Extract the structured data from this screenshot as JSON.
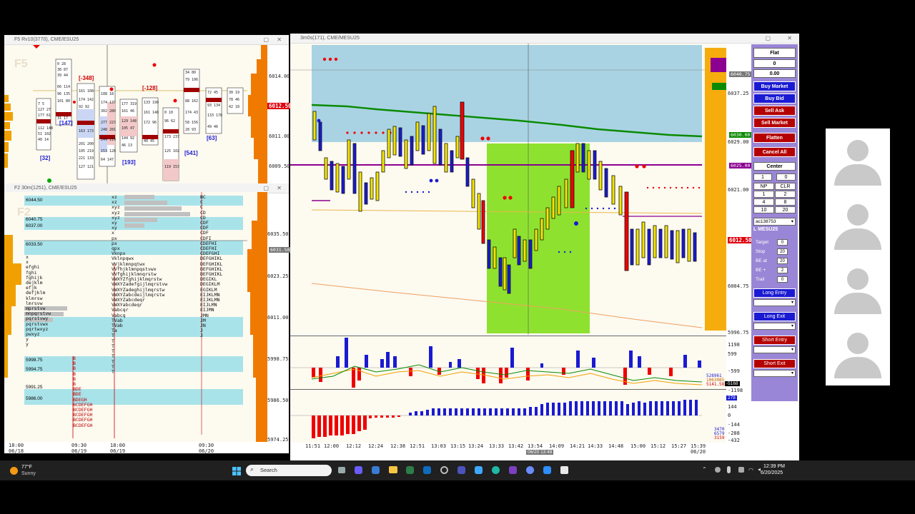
{
  "windows": {
    "f5": {
      "title": "F5 Rv10(3770), CME/ESU25",
      "watermark": "F5"
    },
    "f2": {
      "title": "F2 30m(1251), CME/ESU25",
      "watermark": "F2"
    },
    "main": {
      "title": "3m0s(171), CME/MESU25"
    }
  },
  "f5_prices": [
    "6014.00",
    "6011.00",
    "6009.50"
  ],
  "f5_current": "6012.50",
  "f5_labels": {
    "d1": "[-348]",
    "d2": "[-128]",
    "d3": "[147]",
    "d4": "[32]",
    "d5": "[193]",
    "d6": "[541]",
    "d7": "[63]"
  },
  "f2_left_prices": [
    "6044.50",
    "6040.75",
    "6037.00",
    "6033.50",
    "5998.75",
    "5994.75",
    "5991.25",
    "5986.00"
  ],
  "f2_right_prices": [
    "6035.50",
    "6023.25",
    "6011.00",
    "5998.75",
    "5986.50",
    "5974.25"
  ],
  "f2_tag": "6031.50",
  "f2_times": [
    {
      "t": "18:00",
      "d": "06/18"
    },
    {
      "t": "09:30",
      "d": "06/19"
    },
    {
      "t": "18:00",
      "d": "06/19"
    },
    {
      "t": "09:30",
      "d": "06/20"
    }
  ],
  "main_prices": [
    "6037.25",
    "6029.00",
    "6021.00",
    "6012.50",
    "6004.75",
    "5996.75"
  ],
  "main_tags": {
    "grey": "6040.75",
    "green": "6030.00",
    "purple": "6025.00",
    "red": "6012.50"
  },
  "volume_scale": [
    "1198",
    "599",
    "-599",
    "-1198"
  ],
  "volume_values": [
    "528961",
    "1063085",
    "5141.58",
    "-5168"
  ],
  "delta_scale": [
    "278",
    "144",
    "0",
    "-144",
    "-288",
    "-432"
  ],
  "delta_values": [
    "3470",
    "6579",
    "3159"
  ],
  "main_times": [
    "11:51",
    "12:00",
    "12:12",
    "12:24",
    "12:38",
    "12:51",
    "13:03",
    "13:15",
    "13:24",
    "13:33",
    "13:42",
    "13:54",
    "14:09",
    "14:21",
    "14:33",
    "14:48",
    "15:00",
    "15:12",
    "15:27",
    "15:39"
  ],
  "main_time_last_date": "06/20",
  "cursor_time": "06/20 13:48",
  "panel": {
    "status": "Flat",
    "position": "0",
    "pnl": "0.00",
    "buy_market": "Buy Market",
    "buy_bid": "Buy Bid",
    "sell_ask": "Sell Ask",
    "sell_market": "Sell Market",
    "flatten": "Flatten",
    "cancel_all": "Cancel All",
    "center": "Center",
    "qty": "1",
    "qty_right": "0",
    "np": "NP",
    "clr": "CLR",
    "q_buttons": [
      "1",
      "2",
      "4",
      "8",
      "10",
      "20"
    ],
    "account": "ac138753",
    "symbol": "L MESU25",
    "target_label": "Target",
    "target": "0",
    "stop_label": "Stop",
    "stop": "20",
    "beat_label": "BE at",
    "beat": "20",
    "beplus_label": "BE +",
    "beplus": "2",
    "trail_label": "Trail",
    "trail": "0",
    "long_entry": "Long Entry",
    "long_exit": "Long Exit",
    "short_entry": "Short Entry",
    "short_exit": "Short Exit"
  },
  "taskbar": {
    "weather_temp": "77°F",
    "weather_desc": "Sunny",
    "search_placeholder": "Search",
    "time": "12:39 PM",
    "date": "6/20/2025"
  },
  "colors": {
    "buy": "#1a1ad2",
    "sell": "#b40000",
    "panel": "#9a86d6",
    "value_area": "#8ee22f",
    "upper_zone": "#a9d3e3"
  }
}
